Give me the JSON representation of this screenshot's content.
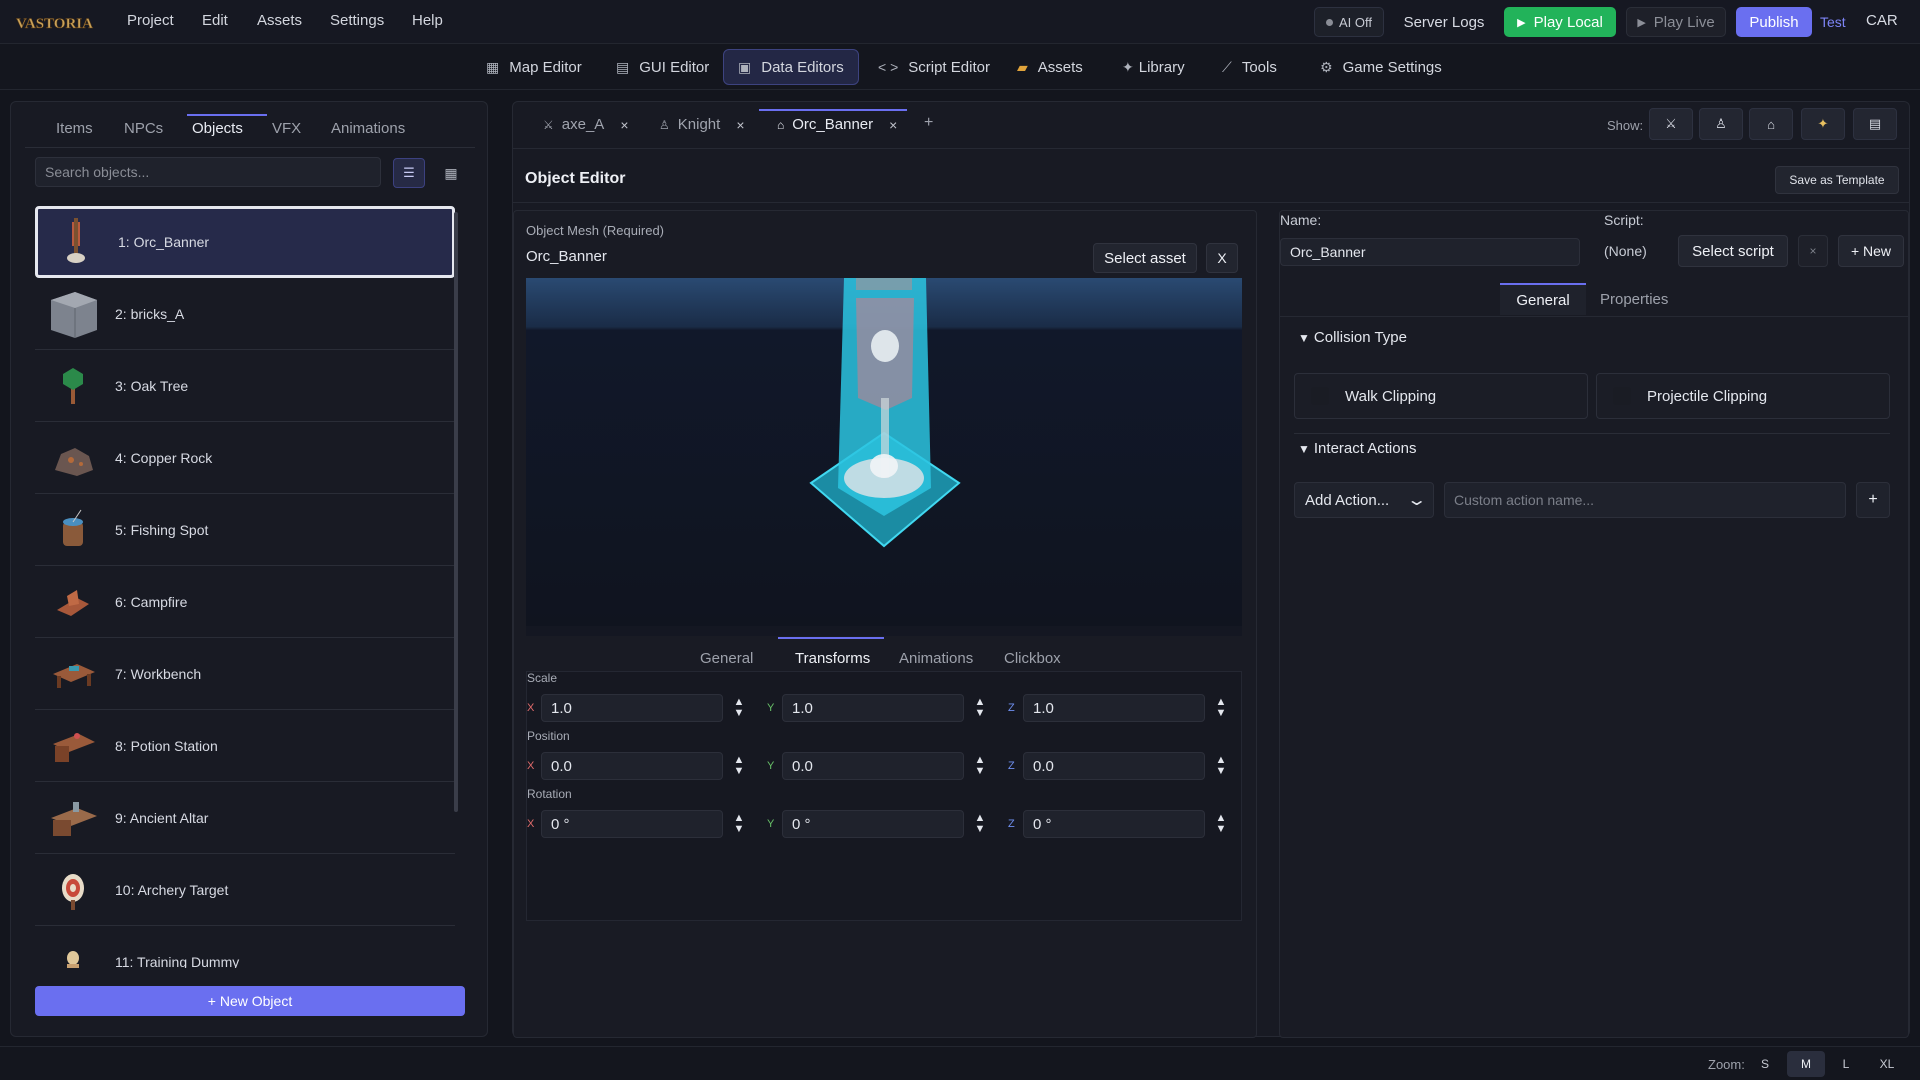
{
  "app": {
    "logo_text": "VASTORIA",
    "menu": [
      "Project",
      "Edit",
      "Assets",
      "Settings",
      "Help"
    ],
    "ai_toggle": "AI Off",
    "server_logs": "Server Logs",
    "play_local": "Play Local",
    "play_live": "Play Live",
    "publish": "Publish",
    "test": "Test",
    "user": "CAR"
  },
  "editor_tabs": [
    {
      "label": "Map Editor",
      "icon": "map-icon"
    },
    {
      "label": "GUI Editor",
      "icon": "gui-icon"
    },
    {
      "label": "Data Editors",
      "icon": "database-icon",
      "active": true
    },
    {
      "label": "Script Editor",
      "icon": "code-icon"
    },
    {
      "label": "Assets",
      "icon": "folder-icon"
    },
    {
      "label": "Library",
      "icon": "sparkle-icon"
    },
    {
      "label": "Tools",
      "icon": "wrench-icon"
    },
    {
      "label": "Game Settings",
      "icon": "gear-icon"
    }
  ],
  "left_panel": {
    "tabs": [
      "Items",
      "NPCs",
      "Objects",
      "VFX",
      "Animations"
    ],
    "active_tab": "Objects",
    "search_placeholder": "Search objects...",
    "objects": [
      "1: Orc_Banner",
      "2: bricks_A",
      "3: Oak Tree",
      "4: Copper Rock",
      "5: Fishing Spot",
      "6: Campfire",
      "7: Workbench",
      "8: Potion Station",
      "9: Ancient Altar",
      "10: Archery Target",
      "11: Training Dummy"
    ],
    "selected_index": 0,
    "new_button": "+ New Object"
  },
  "doc_tabs": [
    {
      "label": "axe_A",
      "icon": "swords-icon"
    },
    {
      "label": "Knight",
      "icon": "person-icon"
    },
    {
      "label": "Orc_Banner",
      "icon": "house-icon",
      "active": true
    }
  ],
  "show_label": "Show:",
  "object_editor": {
    "title": "Object Editor",
    "save_template": "Save as Template",
    "mesh_label": "Object Mesh (Required)",
    "mesh_name": "Orc_Banner",
    "select_asset": "Select asset",
    "clear_asset": "X",
    "sub_tabs": [
      "General",
      "Transforms",
      "Animations",
      "Clickbox"
    ],
    "active_sub_tab": "Transforms",
    "transforms": {
      "scale_label": "Scale",
      "position_label": "Position",
      "rotation_label": "Rotation",
      "scale": [
        "1.0",
        "1.0",
        "1.0"
      ],
      "position": [
        "0.0",
        "0.0",
        "0.0"
      ],
      "rotation": [
        "0 °",
        "0 °",
        "0 °"
      ],
      "axes": [
        "X",
        "Y",
        "Z"
      ]
    }
  },
  "properties": {
    "name_label": "Name:",
    "name_value": "Orc_Banner",
    "script_label": "Script:",
    "script_value": "(None)",
    "select_script": "Select script",
    "clear_script": "×",
    "new_script": "+ New",
    "tabs": [
      "General",
      "Properties"
    ],
    "collision_title": "Collision Type",
    "walk_clipping": "Walk Clipping",
    "projectile_clipping": "Projectile Clipping",
    "interact_title": "Interact Actions",
    "add_action": "Add Action...",
    "custom_action_placeholder": "Custom action name...",
    "add_plus": "+"
  },
  "status": {
    "zoom_label": "Zoom:",
    "zoom_levels": [
      "S",
      "M",
      "L",
      "XL"
    ],
    "active_zoom": "M"
  },
  "colors": {
    "accent": "#6a6ff0",
    "play_green": "#22b35a",
    "viewport_cyan": "#2bc4e0"
  }
}
